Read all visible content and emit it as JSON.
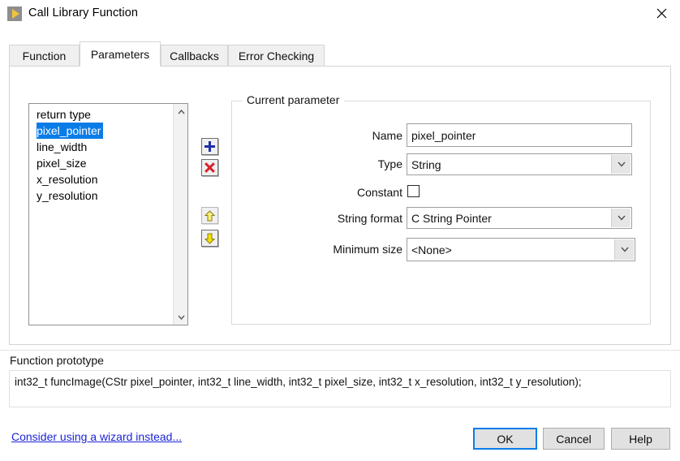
{
  "window": {
    "title": "Call Library Function",
    "icon": "labview-run-arrow-icon",
    "close_label": "✕"
  },
  "tabs": [
    {
      "label": "Function",
      "active": false
    },
    {
      "label": "Parameters",
      "active": true
    },
    {
      "label": "Callbacks",
      "active": false
    },
    {
      "label": "Error Checking",
      "active": false
    }
  ],
  "parameter_list": {
    "items": [
      {
        "label": "return type",
        "selected": false
      },
      {
        "label": "pixel_pointer",
        "selected": true
      },
      {
        "label": "line_width",
        "selected": false
      },
      {
        "label": "pixel_size",
        "selected": false
      },
      {
        "label": "x_resolution",
        "selected": false
      },
      {
        "label": "y_resolution",
        "selected": false
      }
    ],
    "scroll_up": "⌃",
    "scroll_down": "⌄",
    "selection_color": "#0a7ce8"
  },
  "toolbar": {
    "add_label": "+",
    "delete_label": "✕",
    "move_up_label": "↑",
    "move_down_label": "↓"
  },
  "current_parameter": {
    "group_title": "Current parameter",
    "name_label": "Name",
    "name_value": "pixel_pointer",
    "type_label": "Type",
    "type_value": "String",
    "constant_label": "Constant",
    "constant_checked": false,
    "string_format_label": "String format",
    "string_format_value": "C String Pointer",
    "minimum_size_label": "Minimum size",
    "minimum_size_value": "<None>",
    "dropdown_arrow": "⌄"
  },
  "prototype": {
    "label": "Function prototype",
    "text": "int32_t funcImage(CStr pixel_pointer, int32_t line_width, int32_t pixel_size, int32_t x_resolution, int32_t y_resolution);"
  },
  "footer": {
    "wizard_link": "Consider using a wizard instead...",
    "ok_label": "OK",
    "cancel_label": "Cancel",
    "help_label": "Help"
  }
}
